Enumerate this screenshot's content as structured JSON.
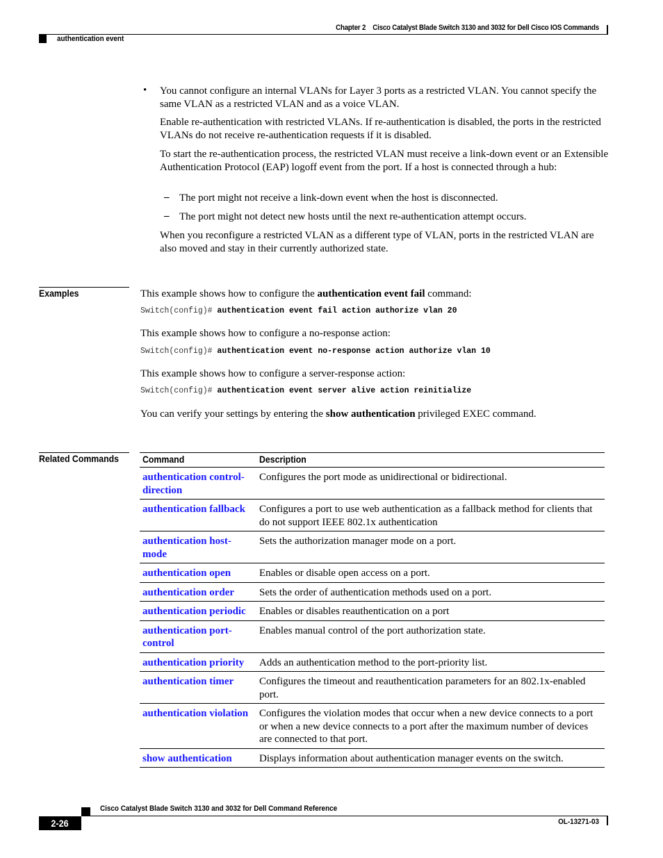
{
  "header": {
    "chapter": "Chapter 2",
    "book_title": "Cisco Catalyst Blade Switch 3130 and 3032 for Dell Cisco IOS Commands",
    "section": "authentication event"
  },
  "intro": {
    "bullet_text": "You cannot configure an internal VLANs for Layer 3 ports as a restricted VLAN. You cannot specify the same VLAN as a restricted VLAN and as a voice VLAN.",
    "para1": "Enable re-authentication with restricted VLANs. If re-authentication is disabled, the ports in the restricted VLANs do not receive re-authentication requests if it is disabled.",
    "para2": "To start the re-authentication process, the restricted VLAN must receive a link-down event or an Extensible Authentication Protocol (EAP) logoff event from the port. If a host is connected through a hub:",
    "dash_items": [
      "The port might not receive a link-down event when the host is disconnected.",
      "The port might not detect new hosts until the next re-authentication attempt occurs."
    ],
    "para3": "When you reconfigure a restricted VLAN as a different type of VLAN, ports in the restricted VLAN are also moved and stay in their currently authorized state."
  },
  "examples": {
    "label": "Examples",
    "items": [
      {
        "intro_before": "This example shows how to configure the ",
        "intro_bold": "authentication event fail",
        "intro_after": " command:",
        "prompt": "Switch(config)# ",
        "command": "authentication event fail action authorize vlan 20"
      },
      {
        "intro": "This example shows how to configure a no-response action:",
        "prompt": "Switch(config)# ",
        "command": "authentication event no-response action authorize vlan 10"
      },
      {
        "intro": "This example shows how to configure a server-response action:",
        "prompt": "Switch(config)# ",
        "command": "authentication event server alive action reinitialize"
      }
    ],
    "verify_before": "You can verify your settings by entering the ",
    "verify_bold": "show authentication",
    "verify_after": " privileged EXEC command."
  },
  "related": {
    "label": "Related Commands",
    "columns": [
      "Command",
      "Description"
    ],
    "link_color": "#1a1aff",
    "rows": [
      {
        "command": "authentication control-direction",
        "description": "Configures the port mode as unidirectional or bidirectional."
      },
      {
        "command": "authentication fallback",
        "description": "Configures a port to use web authentication as a fallback method for clients that do not support IEEE 802.1x authentication"
      },
      {
        "command": "authentication host-mode",
        "description": "Sets the authorization manager mode on a port."
      },
      {
        "command": "authentication open",
        "description": "Enables or disable open access on a port."
      },
      {
        "command": "authentication order",
        "description": "Sets the order of authentication methods used on a port."
      },
      {
        "command": "authentication periodic",
        "description": "Enables or disables reauthentication on a port"
      },
      {
        "command": "authentication port-control",
        "description": "Enables manual control of the port authorization state."
      },
      {
        "command": "authentication priority",
        "description": "Adds an authentication method to the port-priority list."
      },
      {
        "command": "authentication timer",
        "description": "Configures the timeout and reauthentication parameters for an 802.1x-enabled port."
      },
      {
        "command": "authentication violation",
        "description": "Configures the violation modes that occur when a new device connects to a port or when a new device connects to a port after the maximum number of devices are connected to that port."
      },
      {
        "command": "show authentication",
        "description": "Displays information about authentication manager events on the switch."
      }
    ]
  },
  "footer": {
    "title": "Cisco Catalyst Blade Switch 3130 and 3032 for Dell Command Reference",
    "page_number": "2-26",
    "doc_id": "OL-13271-03"
  }
}
